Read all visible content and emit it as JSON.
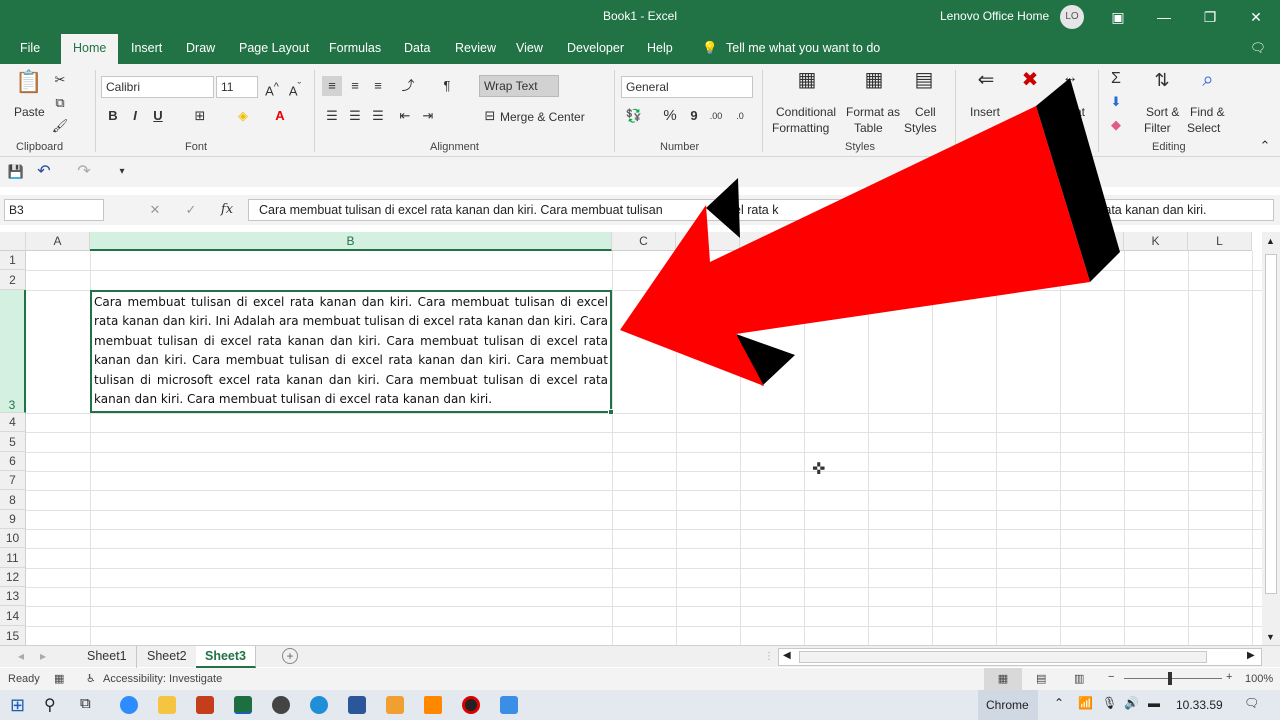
{
  "window": {
    "title": "Book1  -  Excel",
    "account": "Lenovo Office Home",
    "avatar_initials": "LO"
  },
  "menu": {
    "tabs": [
      "File",
      "Home",
      "Insert",
      "Draw",
      "Page Layout",
      "Formulas",
      "Data",
      "Review",
      "View",
      "Developer",
      "Help"
    ],
    "active_tab": "Home",
    "tell_me": "Tell me what you want to do"
  },
  "ribbon": {
    "clipboard": {
      "paste": "Paste",
      "label": "Clipboard"
    },
    "font": {
      "family": "Calibri",
      "size": "11",
      "label": "Font"
    },
    "alignment": {
      "wrap_text": "Wrap Text",
      "merge_center": "Merge & Center",
      "label": "Alignment"
    },
    "number": {
      "format": "General",
      "label": "Number"
    },
    "styles": {
      "conditional_1": "Conditional",
      "conditional_2": "Formatting",
      "format_table_1": "Format as",
      "format_table_2": "Table",
      "cell_styles_1": "Cell",
      "cell_styles_2": "Styles",
      "label": "Styles"
    },
    "cells": {
      "insert": "Insert",
      "delete_partial": "at"
    },
    "editing": {
      "sort_1": "Sort &",
      "sort_2": "Filter",
      "find_1": "Find &",
      "find_2": "Select",
      "label": "Editing"
    }
  },
  "formula_bar": {
    "name_box": "B3",
    "fx": "fx",
    "content_left": "Cara membuat tulisan di excel rata kanan dan kiri. Cara membuat tulisan",
    "content_mid": "el rata k",
    "content_right": "el rata kanan dan kiri."
  },
  "grid": {
    "columns": [
      "A",
      "B",
      "C",
      "",
      "",
      "",
      "",
      "",
      "",
      "K",
      "L"
    ],
    "rows": [
      "1",
      "2",
      "3",
      "4",
      "5",
      "6",
      "7",
      "8",
      "9",
      "10",
      "11",
      "12",
      "13",
      "14",
      "15"
    ],
    "selected_cell": "B3",
    "cell_text": "Cara membuat tulisan di excel rata kanan dan kiri. Cara membuat tulisan di excel rata kanan dan kiri. Ini Adalah ara membuat tulisan di excel rata kanan dan kiri. Cara membuat tulisan di excel rata kanan dan kiri. Cara membuat tulisan di excel rata kanan dan kiri. Cara membuat tulisan di excel rata kanan dan kiri. Cara membuat tulisan di microsoft excel rata kanan dan kiri. Cara membuat tulisan di excel rata kanan dan kiri. Cara membuat tulisan di excel rata kanan dan kiri."
  },
  "sheets": [
    "Sheet1",
    "Sheet2",
    "Sheet3"
  ],
  "active_sheet": "Sheet3",
  "status": {
    "ready": "Ready",
    "accessibility": "Accessibility: Investigate",
    "zoom": "100%"
  },
  "taskbar": {
    "chrome": "Chrome",
    "clock": "10.33.59"
  },
  "colors": {
    "excel_green": "#217346",
    "arrow_red": "#ff0000",
    "arrow_shadow": "#000000"
  }
}
